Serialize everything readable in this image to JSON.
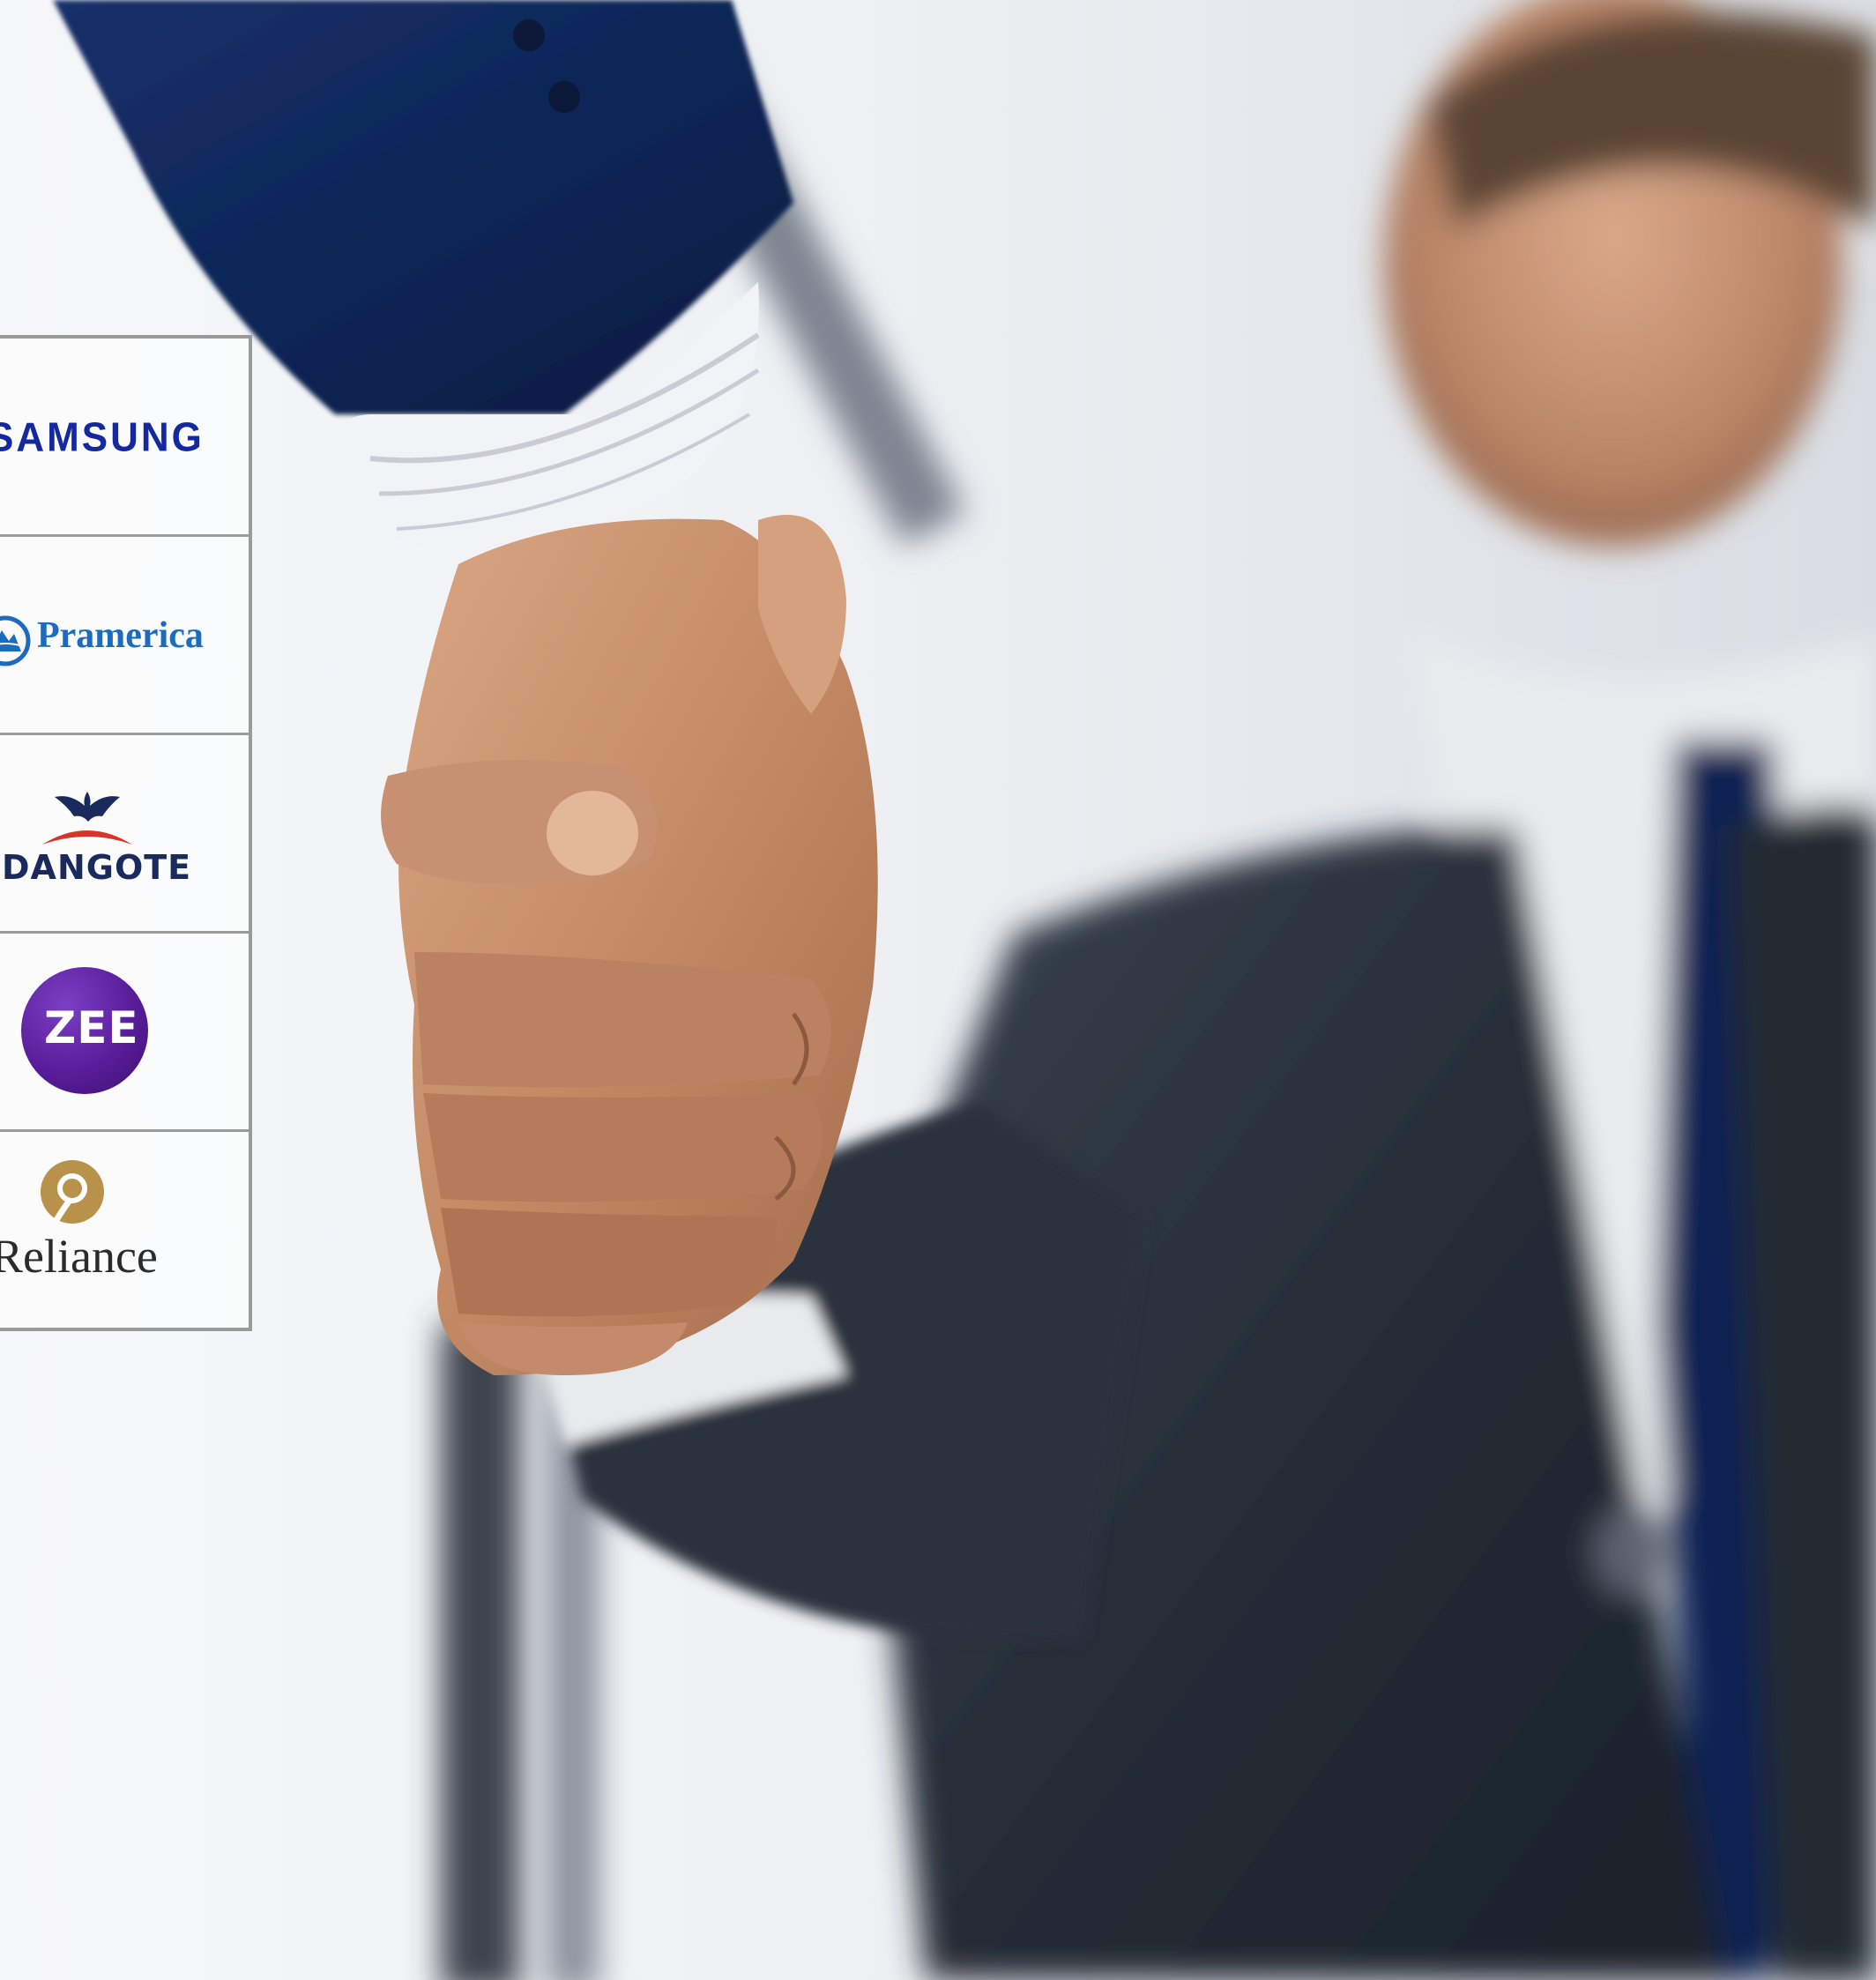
{
  "logos": {
    "samsung": "SAMSUNG",
    "pramerica": "Pramerica",
    "dangote": "DANGOTE",
    "zee": "ZEE",
    "reliance": "Reliance"
  },
  "colors": {
    "samsung_blue": "#1428a0",
    "pramerica_blue": "#1b6bbf",
    "dangote_navy": "#1a2a5c",
    "dangote_red": "#d9342b",
    "zee_purple": "#5a1d9a",
    "reliance_gold": "#b8924a",
    "grid_border": "#9a9a9a"
  },
  "icons": [
    "pramerica-rock-icon",
    "dangote-eagle-icon",
    "reliance-emblem-icon"
  ]
}
